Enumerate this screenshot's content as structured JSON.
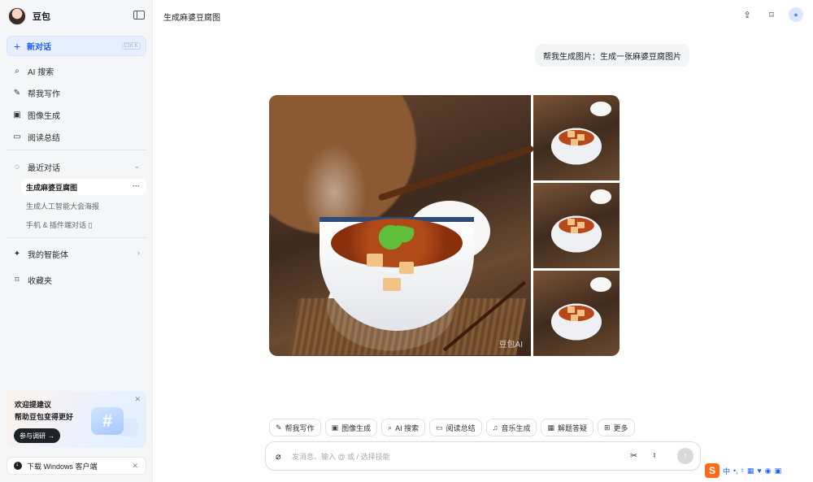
{
  "sidebar": {
    "brand": "豆包",
    "new_chat": {
      "label": "新对话",
      "shortcut": "Ctrl K"
    },
    "nav": [
      {
        "icon": "ai-search-icon",
        "label": "AI 搜索"
      },
      {
        "icon": "pen-icon",
        "label": "帮我写作"
      },
      {
        "icon": "image-icon",
        "label": "图像生成"
      },
      {
        "icon": "book-icon",
        "label": "阅读总结"
      }
    ],
    "recent": {
      "label": "最近对话"
    },
    "conversations": [
      {
        "label": "生成麻婆豆腐图",
        "active": true
      },
      {
        "label": "生成人工智能大会海报",
        "active": false
      },
      {
        "label": "手机 & 插件端对话 ▯",
        "active": false
      }
    ],
    "agents": "我的智能体",
    "favorites": "收藏夹",
    "promo": {
      "line1": "欢迎提建议",
      "line2": "帮助豆包变得更好",
      "button": "参与调研"
    },
    "download": "下载 Windows 客户端"
  },
  "main": {
    "title": "生成麻婆豆腐图",
    "user_message": "帮我生成图片：生成一张麻婆豆腐图片",
    "watermark": "豆包AI",
    "tools": [
      {
        "icon": "pen-icon",
        "label": "帮我写作"
      },
      {
        "icon": "image-icon",
        "label": "图像生成"
      },
      {
        "icon": "ai-search-icon",
        "label": "AI 搜索"
      },
      {
        "icon": "book-icon",
        "label": "阅读总结"
      },
      {
        "icon": "music-icon",
        "label": "音乐生成"
      },
      {
        "icon": "calc-icon",
        "label": "解题答疑"
      },
      {
        "icon": "grid-icon",
        "label": "更多"
      }
    ],
    "input_placeholder": "发消息、输入 @ 或 / 选择技能"
  },
  "ime": {
    "logo": "S",
    "lang": "中"
  },
  "colors": {
    "accent": "#1a5cff",
    "active_bg": "#e7efff",
    "sidebar_bg": "#f5f6f8"
  }
}
